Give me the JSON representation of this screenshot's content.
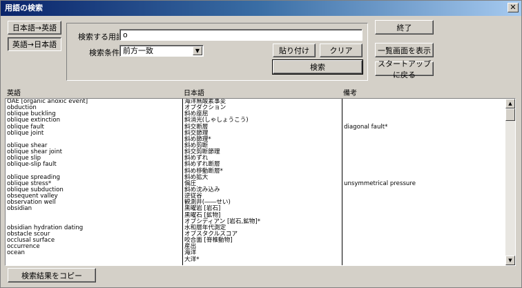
{
  "window": {
    "title": "用語の検索",
    "close_glyph": "✕"
  },
  "mode_buttons": {
    "ja_to_en": "日本語→英語",
    "en_to_ja": "英語→日本語"
  },
  "search": {
    "term_label": "検索する用語:",
    "term_value": "o",
    "condition_label": "検索条件:",
    "condition_value": "前方一致",
    "paste_label": "貼り付け",
    "clear_label": "クリア",
    "search_label": "検索"
  },
  "right_buttons": {
    "exit": "終了",
    "list_view": "一覧画面を表示",
    "back_to_startup": "スタートアップに戻る"
  },
  "results": {
    "headers": {
      "english": "英語",
      "japanese": "日本語",
      "notes": "備考"
    },
    "english": [
      "OAE [organic anoxic event]",
      "obduction",
      "oblique buckling",
      "oblique extinction",
      "oblique fault",
      "oblique joint",
      "",
      "oblique shear",
      "oblique shear joint",
      "oblique slip",
      "oblique-slip fault",
      "",
      "oblique spreading",
      "oblique stress*",
      "oblique subduction",
      "obsequent valley",
      "observation well",
      "obsidian",
      "",
      "",
      "obsidian hydration dating",
      "obstacle scour",
      "occlusal surface",
      "occurrence",
      "ocean",
      ""
    ],
    "japanese": [
      "海洋無酸素事変",
      "オブダクション",
      "斜め座屈",
      "斜消光(しゃしょうこう)",
      "斜交断層",
      "斜交節理",
      "斜め節理*",
      "斜め剪断",
      "斜交剪断節理",
      "斜めずれ",
      "斜めずれ断層",
      "斜め移動断層*",
      "斜め拡大",
      "偏圧",
      "斜め沈み込み",
      "逆従谷",
      "観測井(――せい)",
      "黒曜岩 [岩石]",
      "黒曜石 [鉱物]",
      "オブシディアン [岩石,鉱物]*",
      "水和層年代測定",
      "オブスタクルスコア",
      "咬合面 [脊椎動物]",
      "産出",
      "海洋",
      "大洋*"
    ],
    "notes": [
      "",
      "",
      "",
      "",
      "diagonal fault*",
      "",
      "",
      "",
      "",
      "",
      "",
      "",
      "",
      "unsymmetrical pressure",
      "",
      "",
      "",
      "",
      "",
      "",
      "",
      "",
      "",
      "",
      "",
      ""
    ]
  },
  "scrollbar": {
    "up_glyph": "▲",
    "down_glyph": "▼"
  },
  "copy_button": "検索結果をコピー"
}
